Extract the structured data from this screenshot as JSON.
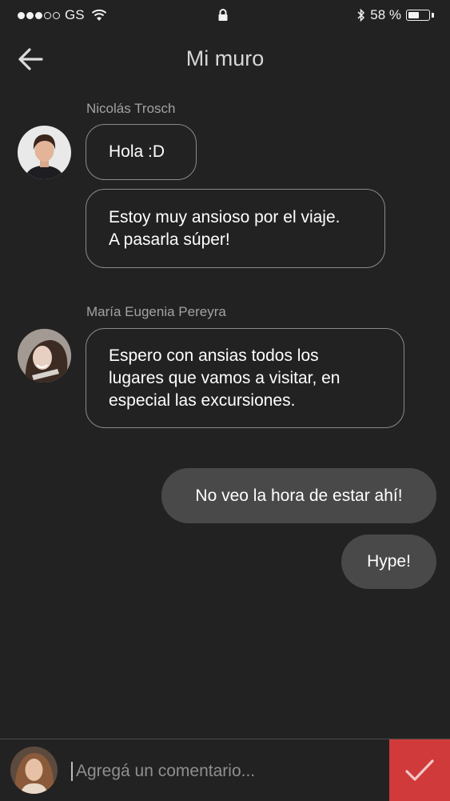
{
  "status_bar": {
    "carrier": "GS",
    "signal_bars_filled": 3,
    "signal_bars_total": 5,
    "battery_text": "58 %",
    "battery_level": 0.58,
    "icons": [
      "wifi-icon",
      "lock-icon",
      "bluetooth-icon",
      "battery-icon"
    ]
  },
  "nav": {
    "title": "Mi muro",
    "back_icon": "back-arrow-icon"
  },
  "messages": [
    {
      "author": "Nicolás Trosch",
      "bubbles": [
        {
          "lines": [
            "Hola :D"
          ]
        },
        {
          "lines": [
            "Estoy muy ansioso por el viaje.",
            "A pasarla súper!"
          ]
        }
      ]
    },
    {
      "author": "María Eugenia Pereyra",
      "bubbles": [
        {
          "lines": [
            "Espero con ansias todos los",
            "lugares que vamos a visitar, en",
            "especial las excursiones."
          ]
        }
      ]
    }
  ],
  "outgoing": [
    {
      "text": "No veo la hora de estar ahí!"
    },
    {
      "text": "Hype!"
    }
  ],
  "composer": {
    "placeholder": "Agregá un comentario...",
    "value": "",
    "send_icon": "checkmark-icon"
  },
  "colors": {
    "background": "#232223",
    "send_button": "#d13a3a",
    "outgoing_bubble": "#4a494a"
  }
}
